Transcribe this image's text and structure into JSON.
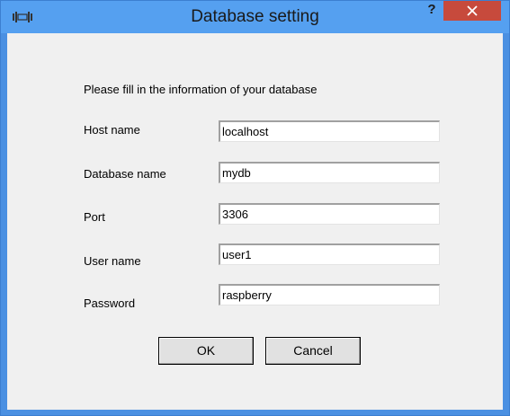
{
  "window": {
    "title": "Database setting",
    "help_label": "?",
    "icons": {
      "app": "app-icon",
      "help": "help-icon",
      "close": "close-icon"
    },
    "colors": {
      "titlebar": "#55a0f0",
      "close_button": "#c74a3c",
      "client_background": "#f0f0f0"
    }
  },
  "form": {
    "intro": "Please fill in the information of your database",
    "fields": [
      {
        "label": "Host name",
        "value": "localhost"
      },
      {
        "label": "Database name",
        "value": "mydb"
      },
      {
        "label": "Port",
        "value": "3306"
      },
      {
        "label": "User name",
        "value": "user1"
      },
      {
        "label": "Password",
        "value": "raspberry"
      }
    ]
  },
  "buttons": {
    "ok_label": "OK",
    "cancel_label": "Cancel"
  }
}
